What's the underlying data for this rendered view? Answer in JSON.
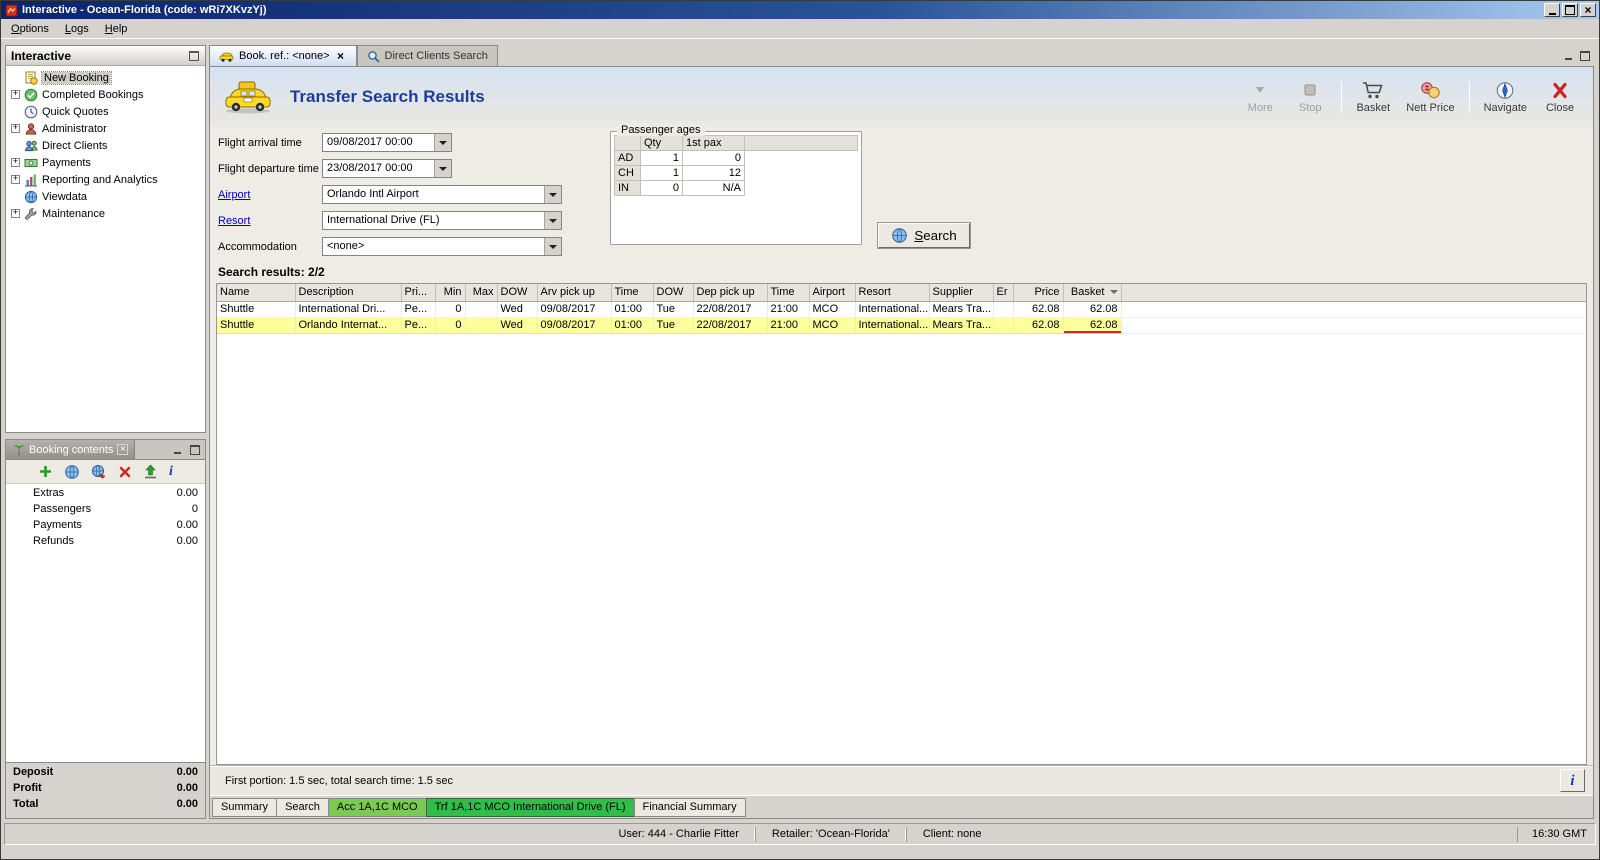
{
  "window": {
    "title": "Interactive - Ocean-Florida (code: wRi7XKvzYj)",
    "menu": [
      "Options",
      "Logs",
      "Help"
    ],
    "status_user": "User: 444 - Charlie Fitter",
    "status_retailer": "Retailer: 'Ocean-Florida'",
    "status_client": "Client: none",
    "clock": "16:30 GMT"
  },
  "sidebar": {
    "title": "Interactive",
    "items": [
      {
        "label": "New Booking",
        "icon": "new-booking-icon",
        "expandable": false,
        "selected": true
      },
      {
        "label": "Completed Bookings",
        "icon": "completed-bookings-icon",
        "expandable": true
      },
      {
        "label": "Quick Quotes",
        "icon": "quick-quotes-icon",
        "expandable": false
      },
      {
        "label": "Administrator",
        "icon": "administrator-icon",
        "expandable": true
      },
      {
        "label": "Direct Clients",
        "icon": "direct-clients-icon",
        "expandable": false
      },
      {
        "label": "Payments",
        "icon": "payments-icon",
        "expandable": true
      },
      {
        "label": "Reporting and Analytics",
        "icon": "reporting-icon",
        "expandable": true
      },
      {
        "label": "Viewdata",
        "icon": "viewdata-icon",
        "expandable": false
      },
      {
        "label": "Maintenance",
        "icon": "maintenance-icon",
        "expandable": true
      }
    ]
  },
  "booking_contents": {
    "title": "Booking contents",
    "toolbar_icons": [
      "add-icon",
      "world-icon",
      "world-edit-icon",
      "delete-icon",
      "export-icon",
      "info-icon"
    ],
    "rows": [
      {
        "label": "Extras",
        "value": "0.00"
      },
      {
        "label": "Passengers",
        "value": "0"
      },
      {
        "label": "Payments",
        "value": "0.00"
      },
      {
        "label": "Refunds",
        "value": "0.00"
      }
    ],
    "totals": [
      {
        "label": "Deposit",
        "value": "0.00"
      },
      {
        "label": "Profit",
        "value": "0.00"
      },
      {
        "label": "Total",
        "value": "0.00"
      }
    ]
  },
  "main": {
    "tabs": [
      {
        "label": "Book. ref.: <none>",
        "icon": "taxi-mini-icon",
        "active": true,
        "closable": true
      },
      {
        "label": "Direct Clients Search",
        "icon": "search-mini-icon",
        "active": false,
        "closable": false
      }
    ],
    "header_title": "Transfer Search Results",
    "toolbar": [
      {
        "label": "More",
        "icon": "more-icon",
        "disabled": true
      },
      {
        "label": "Stop",
        "icon": "stop-icon",
        "disabled": true,
        "sep_after": true
      },
      {
        "label": "Basket",
        "icon": "basket-icon"
      },
      {
        "label": "Nett Price",
        "icon": "nett-price-icon",
        "sep_after": true
      },
      {
        "label": "Navigate",
        "icon": "navigate-icon"
      },
      {
        "label": "Close",
        "icon": "close-icon"
      }
    ],
    "form": {
      "fields": [
        {
          "label": "Flight arrival time",
          "value": "09/08/2017 00:00",
          "wide": false,
          "link": false
        },
        {
          "label": "Flight departure time",
          "value": "23/08/2017 00:00",
          "wide": false,
          "link": false
        },
        {
          "label": "Airport",
          "value": "Orlando Intl Airport",
          "wide": true,
          "link": true
        },
        {
          "label": "Resort",
          "value": "International Drive (FL)",
          "wide": true,
          "link": true
        },
        {
          "label": "Accommodation",
          "value": "<none>",
          "wide": true,
          "link": false
        }
      ]
    },
    "passenger_ages": {
      "title": "Passenger ages",
      "columns": [
        "",
        "Qty",
        "1st pax"
      ],
      "rows": [
        {
          "type": "AD",
          "qty": "1",
          "first_pax": "0"
        },
        {
          "type": "CH",
          "qty": "1",
          "first_pax": "12"
        },
        {
          "type": "IN",
          "qty": "0",
          "first_pax": "N/A"
        }
      ]
    },
    "search_button": "Search",
    "results_label": "Search results: 2/2",
    "results_table": {
      "columns": [
        "Name",
        "Description",
        "Pri...",
        "Min",
        "Max",
        "DOW",
        "Arv pick up",
        "Time",
        "DOW",
        "Dep pick up",
        "Time",
        "Airport",
        "Resort",
        "Supplier",
        "Er",
        "Price",
        "Basket"
      ],
      "selected_row": 1,
      "flagged_basket_row": 1,
      "rows": [
        [
          "Shuttle",
          "International Dri...",
          "Pe...",
          "0",
          "",
          "Wed",
          "09/08/2017",
          "01:00",
          "Tue",
          "22/08/2017",
          "21:00",
          "MCO",
          "International...",
          "Mears Tra...",
          "",
          "62.08",
          "62.08"
        ],
        [
          "Shuttle",
          "Orlando Internat...",
          "Pe...",
          "0",
          "",
          "Wed",
          "09/08/2017",
          "01:00",
          "Tue",
          "22/08/2017",
          "21:00",
          "MCO",
          "International...",
          "Mears Tra...",
          "",
          "62.08",
          "62.08"
        ]
      ]
    },
    "status_line": "First portion: 1.5 sec, total search time: 1.5 sec",
    "bottom_tabs": [
      {
        "label": "Summary",
        "green": false,
        "active": false
      },
      {
        "label": "Search",
        "green": false,
        "active": false
      },
      {
        "label": "Acc 1A,1C MCO",
        "green": true,
        "active": false
      },
      {
        "label": "Trf 1A,1C MCO International Drive (FL)",
        "green": true,
        "active": true
      },
      {
        "label": "Financial Summary",
        "green": false,
        "active": false
      }
    ]
  }
}
